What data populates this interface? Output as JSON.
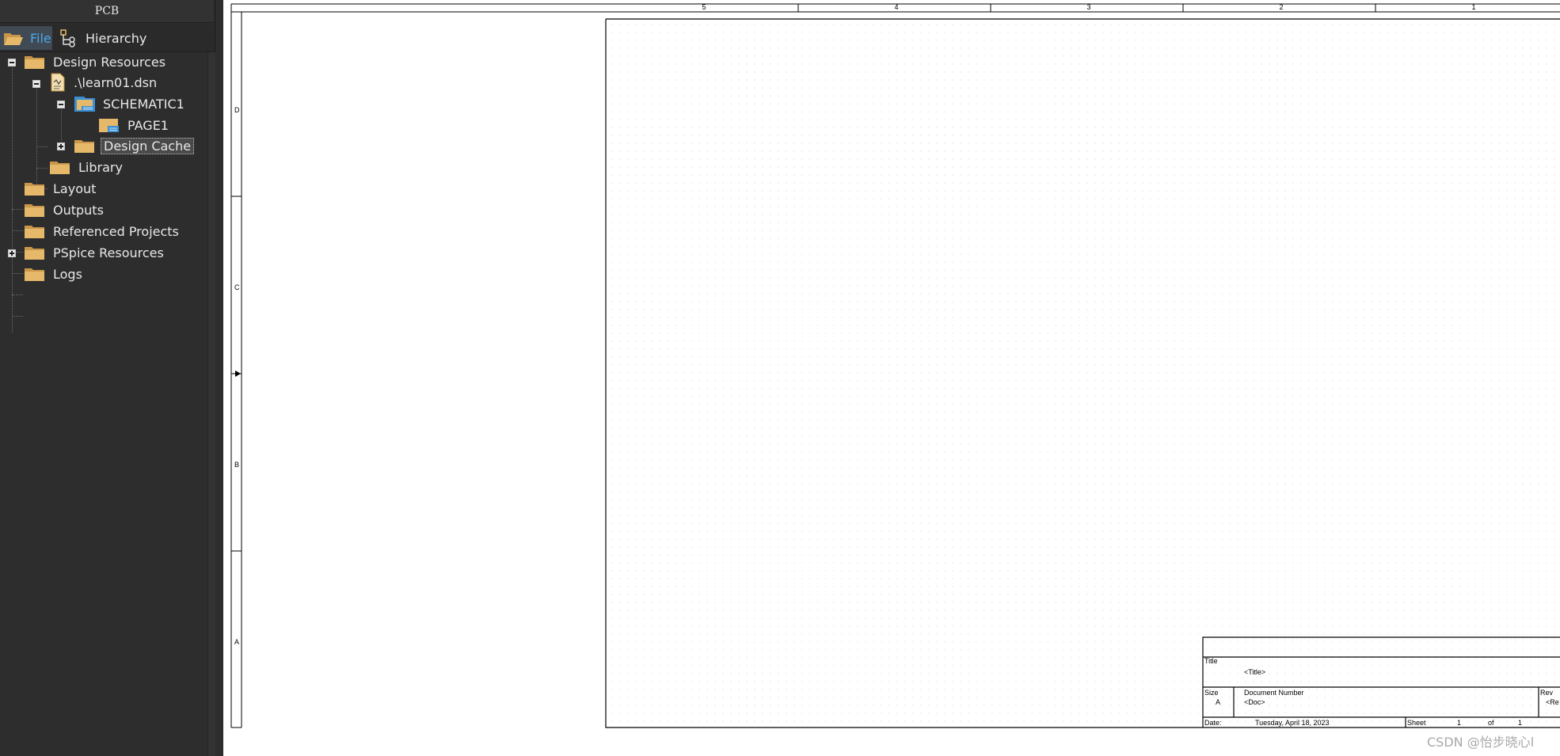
{
  "panel": {
    "title": "PCB",
    "tabs": [
      {
        "label": "File",
        "active": true,
        "icon": "folder-open-icon"
      },
      {
        "label": "Hierarchy",
        "active": false,
        "icon": "hierarchy-icon"
      }
    ]
  },
  "tree": {
    "design_resources": "Design Resources",
    "dsn_file": ".\\learn01.dsn",
    "schematic": "SCHEMATIC1",
    "page": "PAGE1",
    "design_cache": "Design Cache",
    "library": "Library",
    "layout": "Layout",
    "outputs": "Outputs",
    "referenced_projects": "Referenced Projects",
    "pspice_resources": "PSpice Resources",
    "logs": "Logs"
  },
  "sheet": {
    "col_labels": [
      "5",
      "4",
      "3",
      "2",
      "1"
    ],
    "row_labels": [
      "D",
      "C",
      "B",
      "A"
    ],
    "title_block": {
      "title_caption": "Title",
      "title_value": "<Title>",
      "size_caption": "Size",
      "size_value": "A",
      "docnum_caption": "Document Number",
      "docnum_value": "<Doc>",
      "rev_caption": "Rev",
      "rev_value": "<Re",
      "date_caption": "Date:",
      "date_value": "Tuesday, April 18, 2023",
      "sheet_caption": "Sheet",
      "sheet_number": "1",
      "of_caption": "of",
      "sheet_total": "1"
    }
  },
  "watermark": "CSDN @怡步晓心l",
  "colors": {
    "panel_bg": "#2d2d2d",
    "folder": "#e5b86a",
    "tab_active_text": "#4aa8e8",
    "canvas_bg": "#ffffff"
  }
}
